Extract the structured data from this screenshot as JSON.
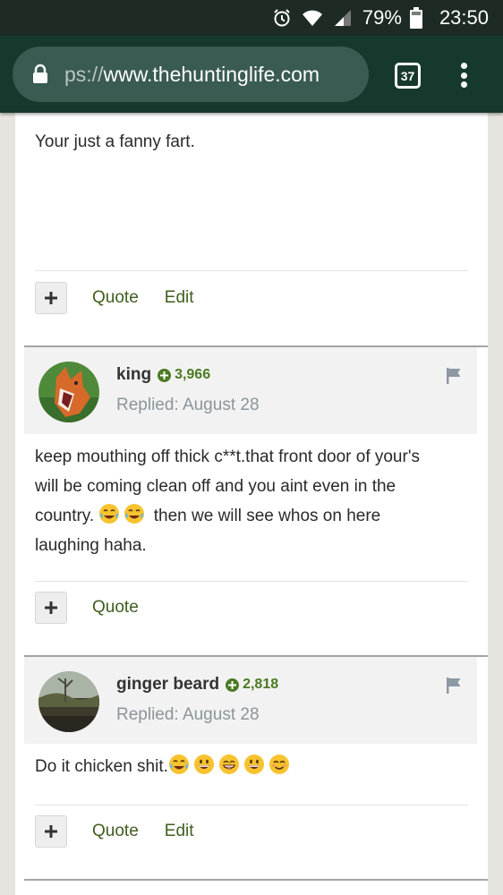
{
  "status_bar": {
    "battery": "79%",
    "time": "23:50",
    "icons": [
      "alarm-icon",
      "wifi-icon",
      "signal-icon",
      "battery-icon"
    ]
  },
  "browser": {
    "url_scheme": "ps://",
    "url_host": "www.thehuntinglife.com",
    "tab_count": "37",
    "icons": [
      "lock-icon",
      "overflow-menu-icon"
    ]
  },
  "colors": {
    "accent_green": "#3f5e1d",
    "reputation_green": "#4b7a22",
    "browser_bar": "#16392e"
  },
  "posts": [
    {
      "body": "Your just a fanny fart.",
      "actions": {
        "quote": "Quote",
        "edit": "Edit"
      }
    },
    {
      "author": "king",
      "reputation": "3,966",
      "replied": "Replied: August 28",
      "body_line1": "keep mouthing off thick c**t.that front door of your's",
      "body_line2": "will be coming clean off and you aint even in the",
      "body_line3_pre": "country.",
      "body_line3_post": " then we will see whos on here",
      "body_line4": "laughing haha.",
      "emojis": [
        "tears-of-joy-emoji",
        "tears-of-joy-emoji"
      ],
      "actions": {
        "quote": "Quote"
      }
    },
    {
      "author": "ginger beard",
      "reputation": "2,818",
      "replied": "Replied: August 28",
      "body": "Do it chicken shit.",
      "emojis": [
        "tears-of-joy-emoji",
        "grinning-face-emoji",
        "beaming-face-emoji",
        "grinning-face-emoji",
        "smiling-face-emoji"
      ],
      "actions": {
        "quote": "Quote",
        "edit": "Edit"
      }
    }
  ]
}
